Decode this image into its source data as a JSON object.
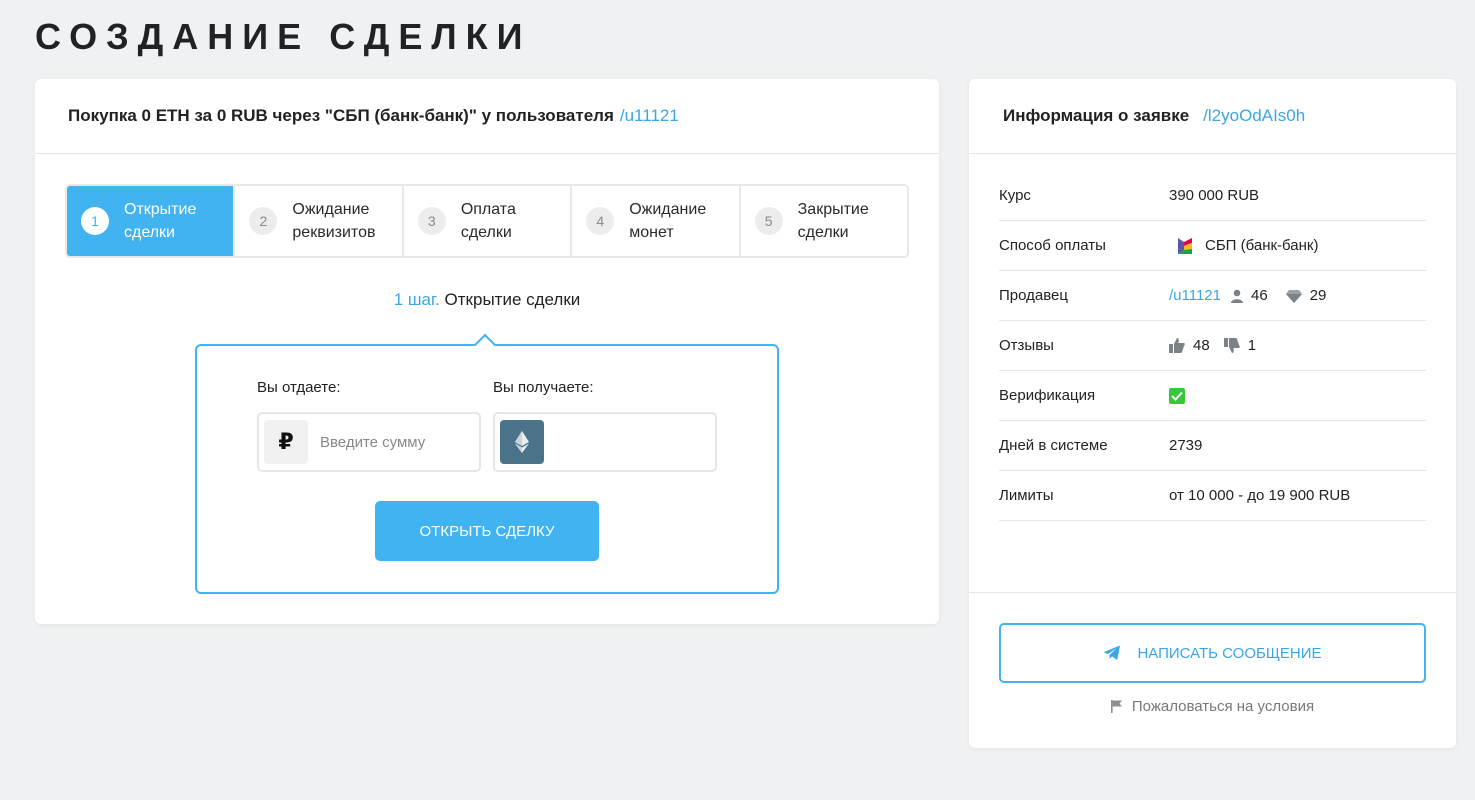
{
  "page": {
    "title": "СОЗДАНИЕ СДЕЛКИ"
  },
  "deal": {
    "header_text": "Покупка 0 ETH за 0 RUB через \"СБП (банк-банк)\" у пользователя",
    "header_user": "/u11121",
    "steps": [
      {
        "num": "1",
        "label": "Открытие\nсделки",
        "active": true
      },
      {
        "num": "2",
        "label": "Ожидание\nреквизитов",
        "active": false
      },
      {
        "num": "3",
        "label": "Оплата\nсделки",
        "active": false
      },
      {
        "num": "4",
        "label": "Ожидание\nмонет",
        "active": false
      },
      {
        "num": "5",
        "label": "Закрытие\nсделки",
        "active": false
      }
    ],
    "step_caption_num": "1 шаг.",
    "step_caption_text": "Открытие сделки",
    "give_label": "Вы отдаете:",
    "get_label": "Вы получаете:",
    "give_placeholder": "Введите сумму",
    "give_currency_icon": "ruble-icon",
    "get_currency_icon": "ethereum-icon",
    "open_button": "ОТКРЫТЬ СДЕЛКУ"
  },
  "info": {
    "title": "Информация о заявке",
    "order_id": "/l2yoOdAIs0h",
    "rate_label": "Курс",
    "rate_value": "390 000 RUB",
    "payment_label": "Способ оплаты",
    "payment_value": "СБП (банк-банк)",
    "seller_label": "Продавец",
    "seller_name": "/u11121",
    "seller_deals": "46",
    "seller_rating": "29",
    "reviews_label": "Отзывы",
    "reviews_positive": "48",
    "reviews_negative": "1",
    "verification_label": "Верификация",
    "verified": true,
    "days_label": "Дней в системе",
    "days_value": "2739",
    "limits_label": "Лимиты",
    "limits_value": "от 10 000 - до 19 900 RUB",
    "message_button": "НАПИСАТЬ СООБЩЕНИЕ",
    "complain_link": "Пожаловаться на условия"
  },
  "colors": {
    "accent": "#41b3f0",
    "link": "#3aa6e6",
    "rate_green": "#3fc43c",
    "eth_tile": "#4a7389",
    "background": "#f0f1f2"
  }
}
